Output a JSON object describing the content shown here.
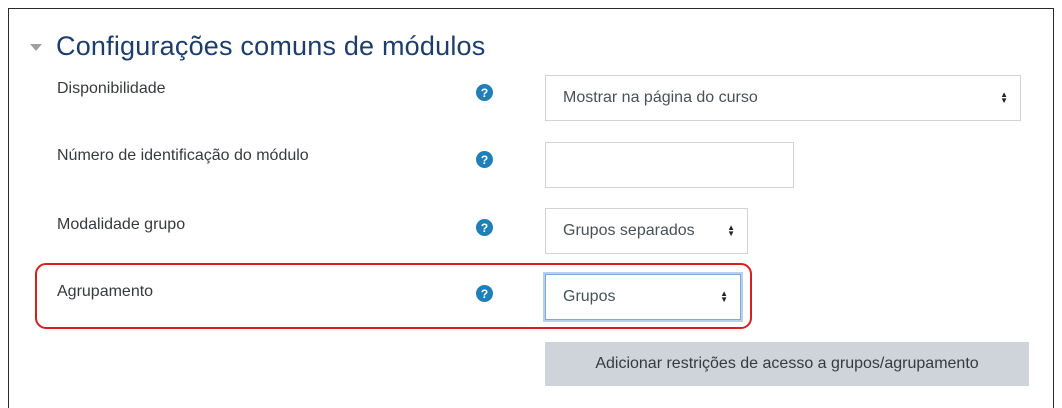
{
  "section": {
    "title": "Configurações comuns de módulos",
    "collapse_icon": "chevron-down-icon"
  },
  "fields": {
    "availability": {
      "label": "Disponibilidade",
      "value": "Mostrar na página do curso"
    },
    "idnumber": {
      "label": "Número de identificação do módulo",
      "value": ""
    },
    "groupmode": {
      "label": "Modalidade grupo",
      "value": "Grupos separados"
    },
    "grouping": {
      "label": "Agrupamento",
      "value": "Grupos"
    }
  },
  "help_icon": {
    "glyph": "?",
    "color": "#1f7fb6"
  },
  "actions": {
    "add_restrictions_label": "Adicionar restrições de acesso a grupos/agrupamento"
  },
  "colors": {
    "title": "#1d3d6b",
    "highlight": "#d71f1f",
    "button_bg": "#ced4da"
  }
}
